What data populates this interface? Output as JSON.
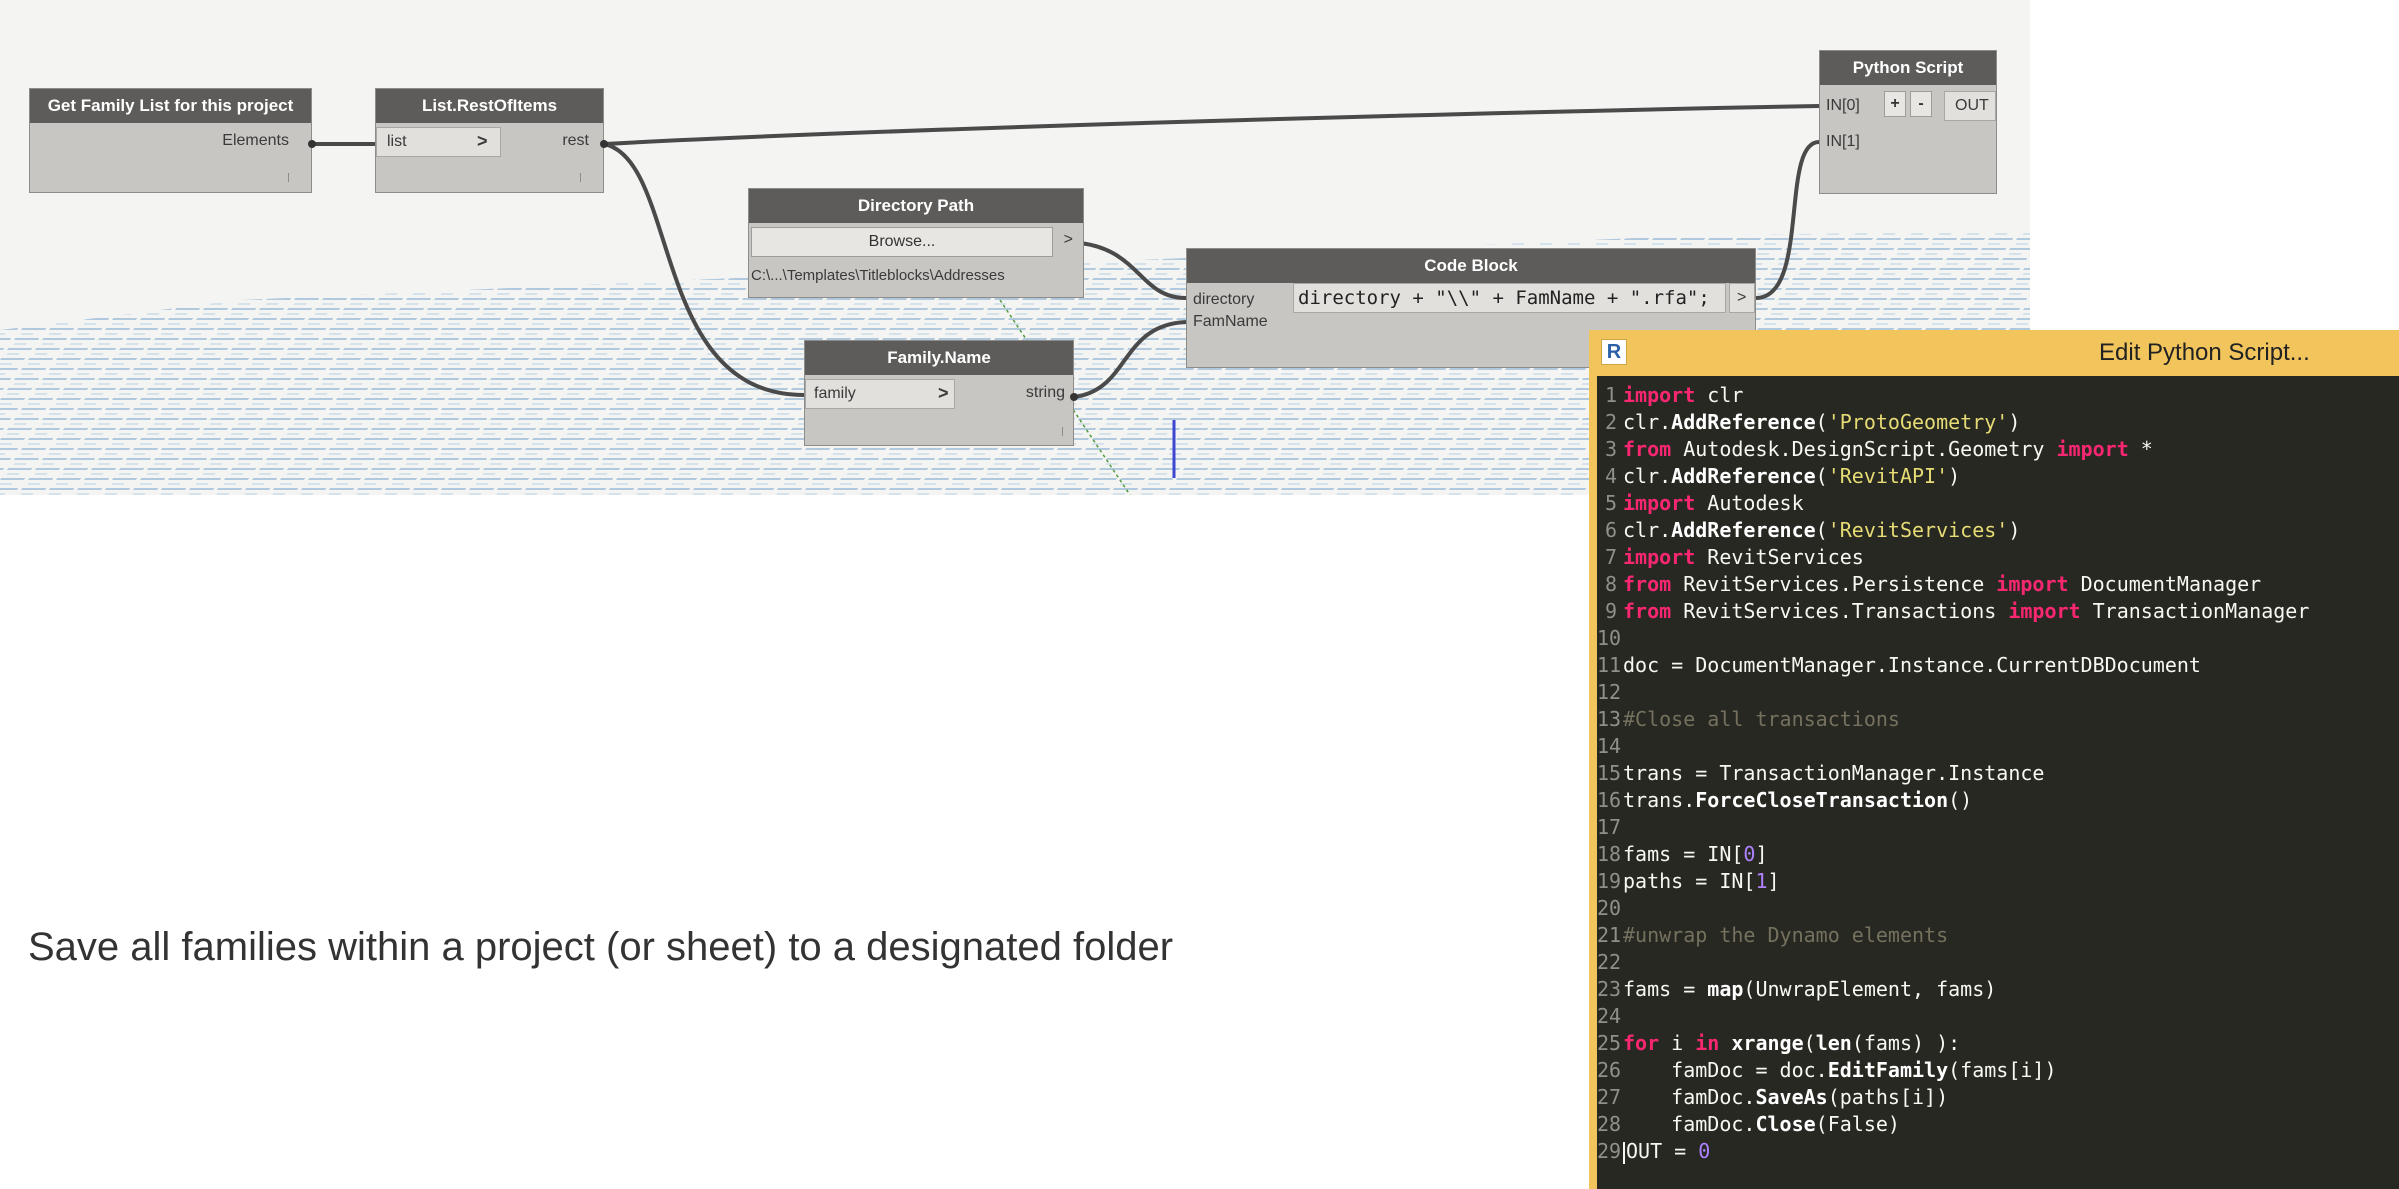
{
  "nodes": {
    "family_list": {
      "title": "Get Family List for this project",
      "output": "Elements"
    },
    "rest_of_items": {
      "title": "List.RestOfItems",
      "input": "list",
      "output": "rest",
      "lacing_glyph": ">"
    },
    "directory_path": {
      "title": "Directory Path",
      "browse_label": "Browse...",
      "path": "C:\\...\\Templates\\Titleblocks\\Addresses",
      "output_glyph": ">"
    },
    "family_name": {
      "title": "Family.Name",
      "input": "family",
      "output": "string",
      "lacing_glyph": ">"
    },
    "code_block": {
      "title": "Code Block",
      "inputs": [
        "directory",
        "FamName"
      ],
      "code": "directory + \"\\\\\" + FamName + \".rfa\";",
      "output_glyph": ">"
    },
    "python_script": {
      "title": "Python Script",
      "inputs": [
        "IN[0]",
        "IN[1]"
      ],
      "add_label": "+",
      "remove_label": "-",
      "output": "OUT"
    }
  },
  "caption": "Save all families within a project (or sheet) to a designated folder",
  "editor": {
    "title": "Edit Python Script...",
    "logo": "R",
    "line_numbers": [
      "1",
      "2",
      "3",
      "4",
      "5",
      "6",
      "7",
      "8",
      "9",
      "10",
      "11",
      "12",
      "13",
      "14",
      "15",
      "16",
      "17",
      "18",
      "19",
      "20",
      "21",
      "22",
      "23",
      "24",
      "25",
      "26",
      "27",
      "28",
      "29"
    ],
    "code": [
      [
        {
          "t": "import",
          "c": "kw"
        },
        {
          "t": " clr",
          "c": ""
        }
      ],
      [
        {
          "t": "clr.",
          "c": ""
        },
        {
          "t": "AddReference",
          "c": "fn"
        },
        {
          "t": "(",
          "c": ""
        },
        {
          "t": "'ProtoGeometry'",
          "c": "st"
        },
        {
          "t": ")",
          "c": ""
        }
      ],
      [
        {
          "t": "from",
          "c": "kw"
        },
        {
          "t": " Autodesk.DesignScript.Geometry ",
          "c": ""
        },
        {
          "t": "import",
          "c": "kw"
        },
        {
          "t": " *",
          "c": ""
        }
      ],
      [
        {
          "t": "clr.",
          "c": ""
        },
        {
          "t": "AddReference",
          "c": "fn"
        },
        {
          "t": "(",
          "c": ""
        },
        {
          "t": "'RevitAPI'",
          "c": "st"
        },
        {
          "t": ")",
          "c": ""
        }
      ],
      [
        {
          "t": "import",
          "c": "kw"
        },
        {
          "t": " Autodesk",
          "c": ""
        }
      ],
      [
        {
          "t": "clr.",
          "c": ""
        },
        {
          "t": "AddReference",
          "c": "fn"
        },
        {
          "t": "(",
          "c": ""
        },
        {
          "t": "'RevitServices'",
          "c": "st"
        },
        {
          "t": ")",
          "c": ""
        }
      ],
      [
        {
          "t": "import",
          "c": "kw"
        },
        {
          "t": " RevitServices",
          "c": ""
        }
      ],
      [
        {
          "t": "from",
          "c": "kw"
        },
        {
          "t": " RevitServices.Persistence ",
          "c": ""
        },
        {
          "t": "import",
          "c": "kw"
        },
        {
          "t": " DocumentManager",
          "c": ""
        }
      ],
      [
        {
          "t": "from",
          "c": "kw"
        },
        {
          "t": " RevitServices.Transactions ",
          "c": ""
        },
        {
          "t": "import",
          "c": "kw"
        },
        {
          "t": " TransactionManager",
          "c": ""
        }
      ],
      [],
      [
        {
          "t": "doc = DocumentManager.Instance.CurrentDBDocument",
          "c": ""
        }
      ],
      [],
      [
        {
          "t": "#Close all transactions",
          "c": "cm"
        }
      ],
      [],
      [
        {
          "t": "trans = TransactionManager.Instance",
          "c": ""
        }
      ],
      [
        {
          "t": "trans.",
          "c": ""
        },
        {
          "t": "ForceCloseTransaction",
          "c": "fn"
        },
        {
          "t": "()",
          "c": ""
        }
      ],
      [],
      [
        {
          "t": "fams = IN[",
          "c": ""
        },
        {
          "t": "0",
          "c": "nm"
        },
        {
          "t": "]",
          "c": ""
        }
      ],
      [
        {
          "t": "paths = IN[",
          "c": ""
        },
        {
          "t": "1",
          "c": "nm"
        },
        {
          "t": "]",
          "c": ""
        }
      ],
      [],
      [
        {
          "t": "#unwrap the Dynamo elements",
          "c": "cm"
        }
      ],
      [],
      [
        {
          "t": "fams = ",
          "c": ""
        },
        {
          "t": "map",
          "c": "fn"
        },
        {
          "t": "(UnwrapElement, fams)",
          "c": ""
        }
      ],
      [],
      [
        {
          "t": "for",
          "c": "kw"
        },
        {
          "t": " i ",
          "c": ""
        },
        {
          "t": "in",
          "c": "kw"
        },
        {
          "t": " ",
          "c": ""
        },
        {
          "t": "xrange",
          "c": "fn"
        },
        {
          "t": "(",
          "c": ""
        },
        {
          "t": "len",
          "c": "fn"
        },
        {
          "t": "(fams) ):",
          "c": ""
        }
      ],
      [
        {
          "t": "    famDoc = doc.",
          "c": ""
        },
        {
          "t": "EditFamily",
          "c": "fn"
        },
        {
          "t": "(fams[i])",
          "c": ""
        }
      ],
      [
        {
          "t": "    famDoc.",
          "c": ""
        },
        {
          "t": "SaveAs",
          "c": "fn"
        },
        {
          "t": "(paths[i])",
          "c": ""
        }
      ],
      [
        {
          "t": "    famDoc.",
          "c": ""
        },
        {
          "t": "Close",
          "c": "fn"
        },
        {
          "t": "(False)",
          "c": ""
        }
      ],
      [
        {
          "t": "OUT = ",
          "c": "",
          "cursor": true
        },
        {
          "t": "0",
          "c": "nm"
        }
      ]
    ]
  },
  "colors": {
    "canvas": "#f4f4f3",
    "node_header": "#5d5c5a",
    "node_body": "#c8c6c2",
    "editor_bg": "#272822",
    "editor_title": "#f2c55c",
    "keyword": "#f92672",
    "string": "#e6db74",
    "number": "#ae81ff",
    "comment": "#75715e"
  },
  "icons": {
    "lacing": "chevron-right-icon",
    "editor_logo": "revit-logo-icon"
  }
}
